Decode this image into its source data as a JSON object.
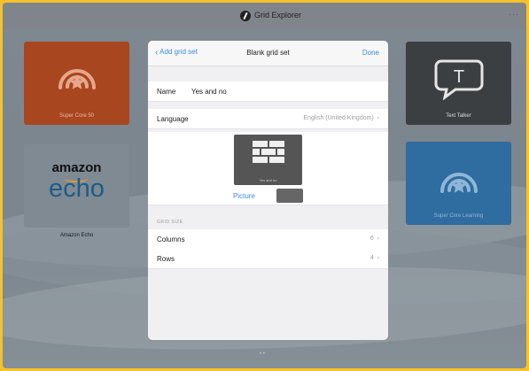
{
  "window": {
    "title": "Grid Explorer",
    "more": "···"
  },
  "tiles": {
    "super_core_50": "Super Core 50",
    "amazon_echo": "Amazon Echo",
    "amazon_word": "amazon",
    "echo_word": "echo",
    "text_talker": "Text Talker",
    "text_talker_glyph": "T",
    "super_core_learning": "Super Core Learning"
  },
  "sheet": {
    "back_label": "Add grid set",
    "title": "Blank grid set",
    "done_label": "Done",
    "name_label": "Name",
    "name_value": "Yes and no",
    "language_label": "Language",
    "language_value": "English (United Kingdom)",
    "picture_caption": "Yes and no",
    "picture_label": "Picture",
    "grid_size_header": "GRID SIZE",
    "columns_label": "Columns",
    "columns_value": "6",
    "rows_label": "Rows",
    "rows_value": "4"
  },
  "pagination": "• •",
  "colors": {
    "frame": "#f5c22a",
    "orange_tile": "#a8461f",
    "dark_tile": "#3c3f42",
    "blue_tile": "#2f6ca0",
    "accent": "#3b8de0"
  }
}
